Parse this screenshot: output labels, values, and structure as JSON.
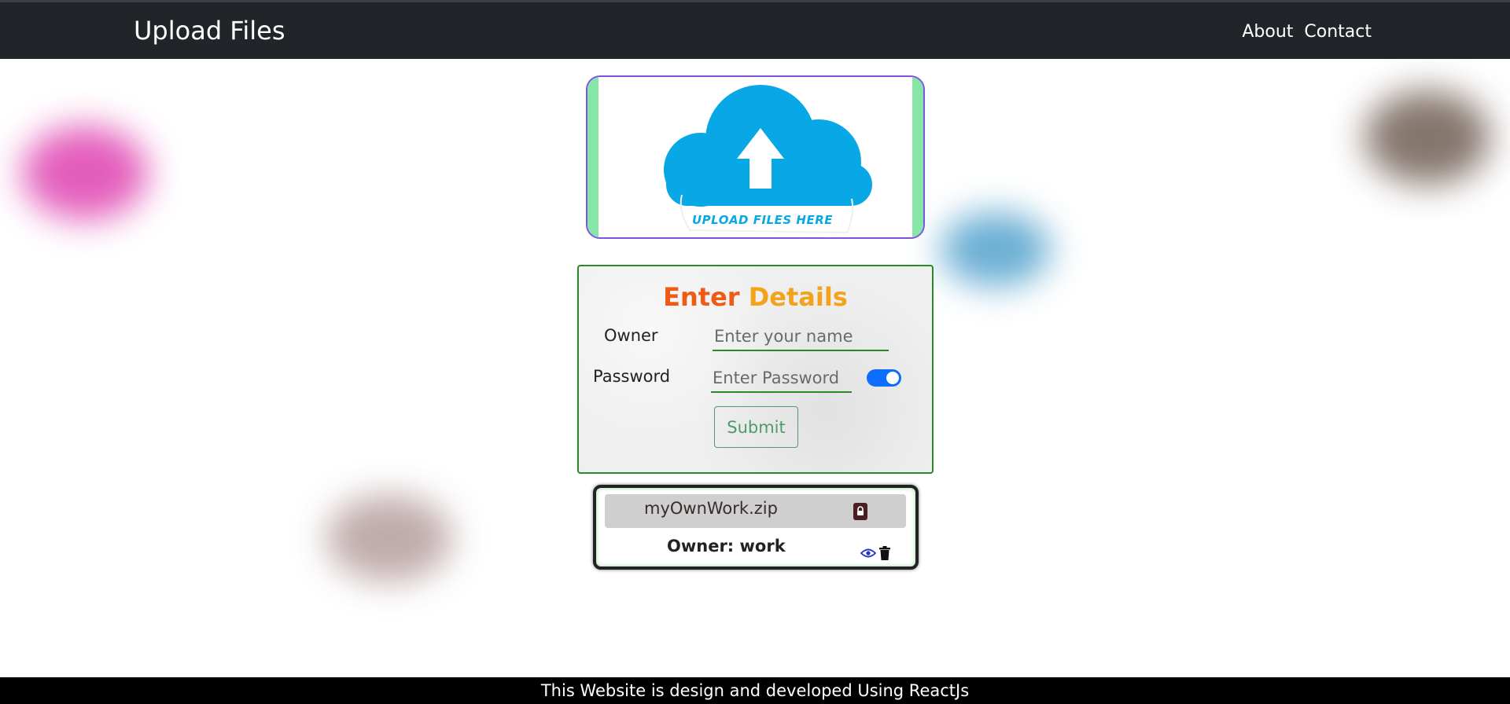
{
  "navbar": {
    "brand": "Upload Files",
    "links": [
      "About",
      "Contact"
    ]
  },
  "upload": {
    "caption": "UPLOAD FILES HERE",
    "icon": "cloud-upload-icon"
  },
  "details": {
    "title_part1": "Enter",
    "title_part2": "Details",
    "owner_label": "Owner",
    "owner_placeholder": "Enter your name",
    "password_label": "Password",
    "password_placeholder": "Enter Password",
    "submit_label": "Submit",
    "toggle_on": true
  },
  "file": {
    "name": "myOwnWork.zip",
    "owner": "Owner: work"
  },
  "footer": {
    "text": "This Website is design and developed Using ReactJs"
  },
  "colors": {
    "navbar_bg": "#212529",
    "accent_blue": "#0d6efd",
    "cloud": "#08a7e6",
    "form_border": "#2a8a2a",
    "title_orange": "#ef5b14",
    "title_yellow": "#f5a21b"
  }
}
